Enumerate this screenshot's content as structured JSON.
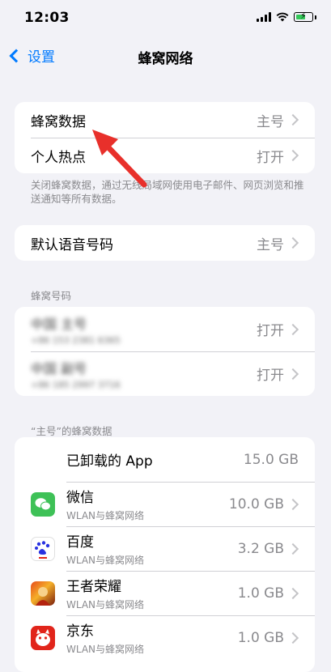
{
  "status_bar": {
    "time": "12:03"
  },
  "nav": {
    "back_label": "设置",
    "title": "蜂窝网络"
  },
  "group1": {
    "rows": [
      {
        "label": "蜂窝数据",
        "value": "主号"
      },
      {
        "label": "个人热点",
        "value": "打开"
      }
    ],
    "footer": "关闭蜂窝数据，通过无线局域网使用电子邮件、网页浏览和推送通知等所有数据。"
  },
  "group2": {
    "rows": [
      {
        "label": "默认语音号码",
        "value": "主号"
      }
    ]
  },
  "sim_section": {
    "header": "蜂窝号码",
    "rows": [
      {
        "title": "中国 主号",
        "subtitle": "+86 153 2381 6365",
        "value": "打开"
      },
      {
        "title": "中国 副号",
        "subtitle": "+86 185 2997 3716",
        "value": "打开"
      }
    ]
  },
  "usage_section": {
    "header": "“主号”的蜂窝数据",
    "apps": [
      {
        "name": "已卸载的 App",
        "subtitle": "",
        "usage": "15.0 GB",
        "icon": "none"
      },
      {
        "name": "微信",
        "subtitle": "WLAN与蜂窝网络",
        "usage": "10.0 GB",
        "icon": "wechat-icon"
      },
      {
        "name": "百度",
        "subtitle": "WLAN与蜂窝网络",
        "usage": "3.2 GB",
        "icon": "baidu-icon"
      },
      {
        "name": "王者荣耀",
        "subtitle": "WLAN与蜂窝网络",
        "usage": "1.0 GB",
        "icon": "honor-of-kings-icon"
      },
      {
        "name": "京东",
        "subtitle": "WLAN与蜂窝网络",
        "usage": "1.0 GB",
        "icon": "jd-icon"
      }
    ]
  },
  "colors": {
    "accent": "#007aff",
    "annotation_arrow": "#e8302b",
    "background": "#f2f2f7"
  }
}
